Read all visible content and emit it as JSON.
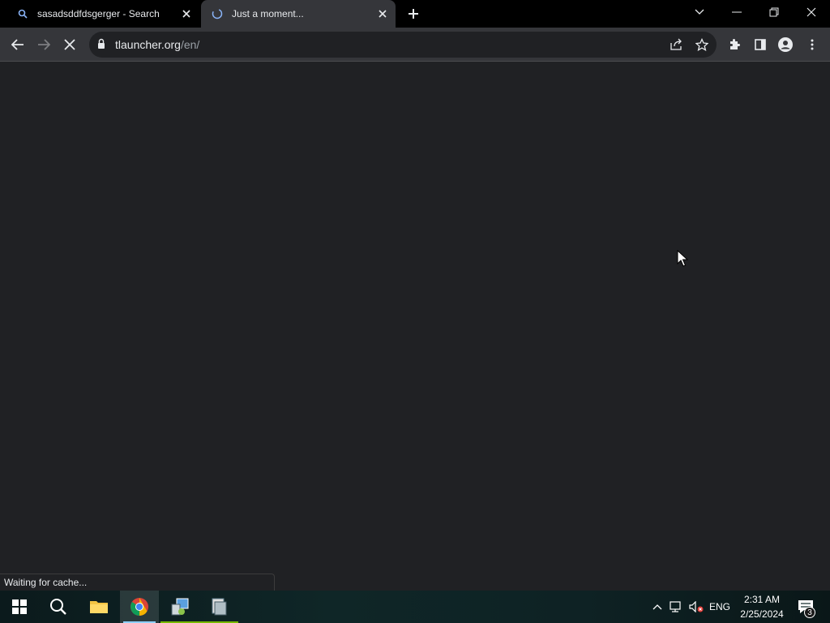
{
  "tabs": [
    {
      "title": "sasadsddfdsgerger - Search",
      "favicon": "search-icon",
      "active": false
    },
    {
      "title": "Just a moment...",
      "favicon": "loading-globe-icon",
      "active": true
    }
  ],
  "toolbar": {
    "url_host": "tlauncher.org",
    "url_path": "/en/"
  },
  "status": {
    "text": "Waiting for cache..."
  },
  "tray": {
    "language": "ENG",
    "time": "2:31 AM",
    "date": "2/25/2024",
    "notifications": "3"
  },
  "colors": {
    "tabstrip_bg": "#000000",
    "active_tab_bg": "#35363a",
    "content_bg": "#202124",
    "taskbar_bg": "#0f2627"
  }
}
